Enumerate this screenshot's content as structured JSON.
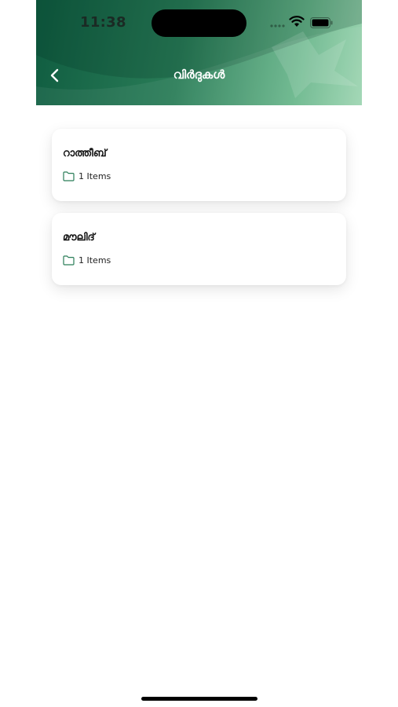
{
  "status_bar": {
    "time": "11:38"
  },
  "header": {
    "title": "വിർദുകൾ",
    "back_icon": "chevron-left-icon"
  },
  "list": {
    "items": [
      {
        "title": "റാത്തീബ്",
        "count_label": "1 Items",
        "icon": "folder-icon"
      },
      {
        "title": "മൗലിദ്",
        "count_label": "1 Items",
        "icon": "folder-icon"
      }
    ]
  },
  "colors": {
    "header_dark": "#0f5c40",
    "header_light": "#9fd6b3",
    "accent": "#2a7d58"
  }
}
